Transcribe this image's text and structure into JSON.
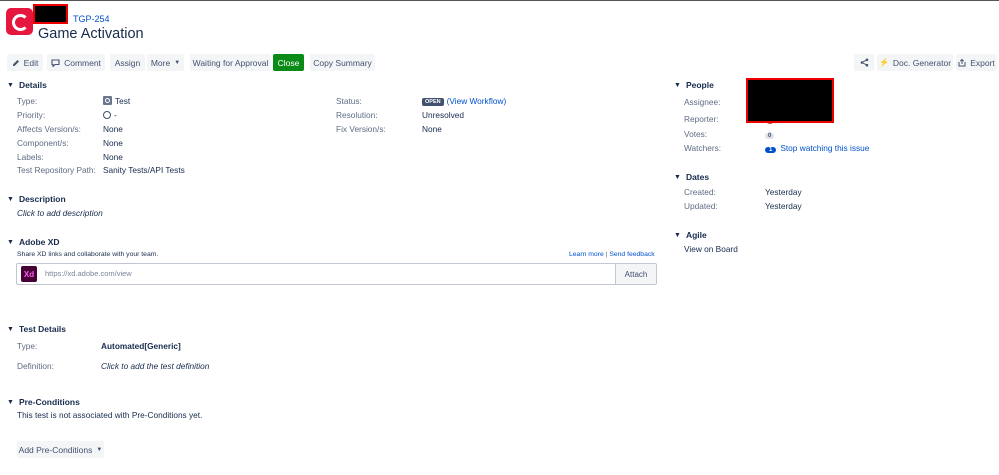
{
  "header": {
    "issue_key": "TGP-254",
    "title": "Game Activation"
  },
  "toolbar": {
    "edit": "Edit",
    "comment": "Comment",
    "assign": "Assign",
    "more": "More",
    "waiting": "Waiting for Approval",
    "close": "Close",
    "copy_summary": "Copy Summary",
    "doc_generator": "Doc. Generator",
    "export": "Export"
  },
  "details": {
    "title": "Details",
    "type_label": "Type:",
    "type_value": "Test",
    "priority_label": "Priority:",
    "priority_value": "-",
    "affects_label": "Affects Version/s:",
    "affects_value": "None",
    "components_label": "Component/s:",
    "components_value": "None",
    "labels_label": "Labels:",
    "labels_value": "None",
    "repo_label": "Test Repository Path:",
    "repo_value": "Sanity Tests/API Tests",
    "status_label": "Status:",
    "status_value": "OPEN",
    "workflow_link": "(View Workflow)",
    "resolution_label": "Resolution:",
    "resolution_value": "Unresolved",
    "fix_label": "Fix Version/s:",
    "fix_value": "None"
  },
  "description": {
    "title": "Description",
    "placeholder": "Click to add description"
  },
  "adobe_xd": {
    "title": "Adobe XD",
    "subtitle": "Share XD links and collaborate with your team.",
    "learn_more": "Learn more",
    "separator": "|",
    "send_feedback": "Send feedback",
    "logo": "Xd",
    "input_placeholder": "https://xd.adobe.com/view",
    "attach": "Attach"
  },
  "test_details": {
    "title": "Test Details",
    "type_label": "Type:",
    "type_value": "Automated[Generic]",
    "definition_label": "Definition:",
    "definition_value": "Click to add the test definition"
  },
  "preconditions": {
    "title": "Pre-Conditions",
    "text": "This test is not associated with Pre-Conditions yet.",
    "add_button": "Add Pre-Conditions"
  },
  "people": {
    "title": "People",
    "assignee_label": "Assignee:",
    "reporter_label": "Reporter:",
    "votes_label": "Votes:",
    "votes_value": "0",
    "watchers_label": "Watchers:",
    "watchers_count": "1",
    "watch_link": "Stop watching this issue"
  },
  "dates": {
    "title": "Dates",
    "created_label": "Created:",
    "created_value": "Yesterday",
    "updated_label": "Updated:",
    "updated_value": "Yesterday"
  },
  "agile": {
    "title": "Agile",
    "board_link": "View on Board"
  },
  "colors": {
    "accent": "#0052cc",
    "close_button": "#0a8a16",
    "project_avatar": "#e5173f",
    "redaction": "#000000"
  }
}
